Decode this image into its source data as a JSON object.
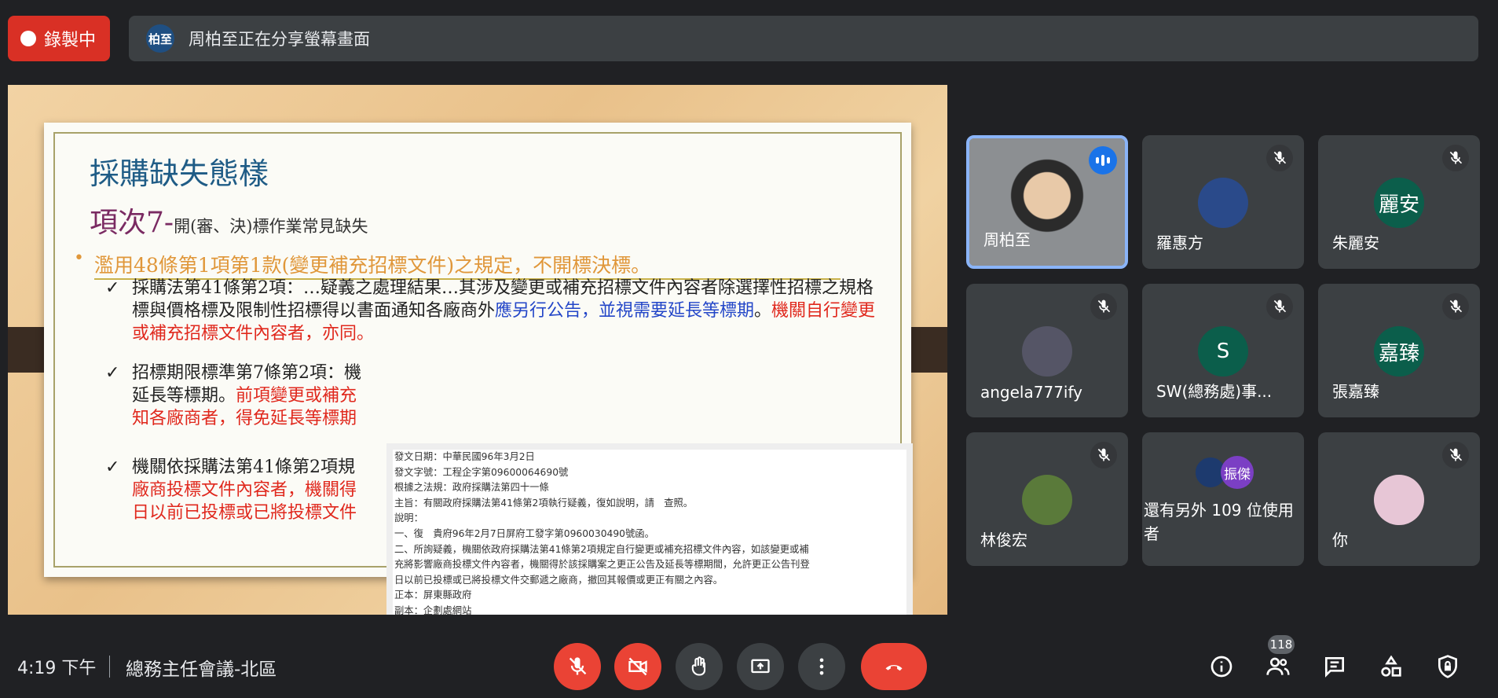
{
  "recording": {
    "label": "錄製中"
  },
  "share_banner": {
    "avatar_text": "柏至",
    "text": "周柏至正在分享螢幕畫面"
  },
  "slide": {
    "title": "採購缺失態樣",
    "subtitle_main": "項次7-",
    "subtitle_small": "開(審、決)標作業常見缺失",
    "bullet": "濫用48條第1項第1款(變更補充招標文件)之規定，不開標決標。",
    "check1": {
      "a": "採購法第41條第2項：…疑義之處理結果…其涉及變更或補充招標文件內容者除選擇性招標之規格標與價格標及限制性招標得以書面通知各廠商外",
      "b": "應另行公告，並視需要延長等標期",
      "c": "。",
      "d": "機關自行變更或補充招標文件內容者，亦同。"
    },
    "check2": {
      "a": "招標期限標準第7條第2項：機",
      "b": "延長等標期。",
      "c": "前項變更或補充",
      "d": "知各廠商者，得免延長等標期"
    },
    "check3": {
      "a": "機關依採購法第41條第2項規",
      "b": "廠商投標文件內容者，機關得",
      "c": "日以前已投標或已將投標文件"
    },
    "check_mark": "✓",
    "doc_lines": [
      "發文日期：中華民國96年3月2日",
      "發文字號：工程企字第09600064690號",
      "根據之法規：政府採購法第四十一條",
      "主旨：有關政府採購法第41條第2項執行疑義，復如說明，請　查照。",
      "說明：",
      "一、復　貴府96年2月7日屏府工發字第0960030490號函。",
      "二、所詢疑義，機關依政府採購法第41條第2項規定自行變更或補充招標文件內容，如該變更或補",
      "充將影響廠商投標文件內容者，機關得於該採購案之更正公告及延長等標期間，允許更正公告刊登",
      "日以前已投標或已將投標文件交郵遞之廠商，撤回其報價或更正有關之內容。",
      "正本：屏東縣政府",
      "副本：企劃處網站"
    ]
  },
  "participants": [
    {
      "name": "周柏至",
      "speaking": true
    },
    {
      "name": "羅惠方",
      "muted": true
    },
    {
      "name": "朱麗安",
      "initials": "麗安",
      "color": "#0b5e4b",
      "muted": true
    },
    {
      "name": "angela777ify",
      "muted": true
    },
    {
      "name": "SW(總務處)事...",
      "initials": "S",
      "color": "#0b5e4b",
      "muted": true
    },
    {
      "name": "張嘉臻",
      "initials": "嘉臻",
      "color": "#0b5e4b",
      "muted": true
    },
    {
      "name": "林俊宏",
      "muted": true
    },
    {
      "name": "還有另外 109 位使用者",
      "initials": "振傑",
      "color": "#7b3fc4"
    },
    {
      "name": "你",
      "muted": true
    }
  ],
  "bottom": {
    "time": "4:19 下午",
    "meeting": "總務主任會議-北區",
    "people_count": "118"
  }
}
